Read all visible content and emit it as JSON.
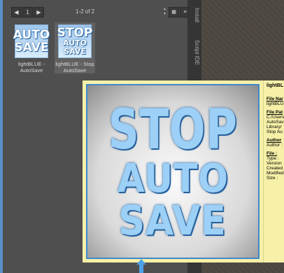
{
  "toolbar": {
    "back_icon": "triangle-left",
    "page_number": "1",
    "forward_icon": "triangle-right",
    "page_count": "1-2 of 2",
    "zoom_icon": "up-down-arrows",
    "grid_view_icon": "grid",
    "list_view_icon": "list"
  },
  "tiles": [
    {
      "thumb_line1": "AUTO",
      "thumb_line2": "SAVE",
      "label": "lightBLUE - AutoSave"
    },
    {
      "thumb_line1": "STOP",
      "thumb_line2": "AUTO SAVE",
      "label": "lightBLUE - Stop AutoSave"
    }
  ],
  "side_tabs": [
    "Install",
    "Script IDE"
  ],
  "preview": {
    "line1": "STOP",
    "line2": "AUTO",
    "line3": "SAVE"
  },
  "info": {
    "title": "lightBL",
    "file_name_header": "File Nar",
    "file_name_value": "lightBLU",
    "file_path_header": "File Pat",
    "file_path_lines": [
      "C:/Users",
      "AutoSav",
      "Library/",
      "Stop Au"
    ],
    "author_header": "Author",
    "author_value": "Author :",
    "file_header": "File :",
    "file_fields": [
      "Type :",
      "Version",
      "Created",
      "Modified",
      "Size :"
    ]
  },
  "colors": {
    "accent": "#5b8fc7",
    "tooltip_bg": "#f6f0a8",
    "arrow": "#4ea0e8"
  }
}
